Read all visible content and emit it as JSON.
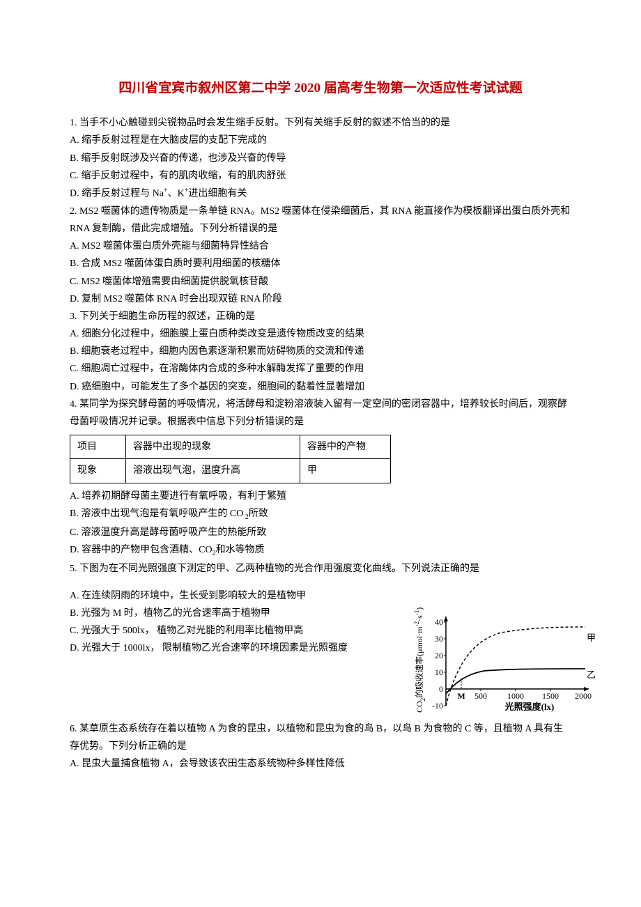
{
  "title": "四川省宜宾市叙州区第二中学 2020 届高考生物第一次适应性考试试题",
  "q1": {
    "stem": "1. 当手不小心触碰到尖锐物品时会发生缩手反射。下列有关缩手反射的叙述不恰当的的是",
    "A": "A. 缩手反射过程是在大脑皮层的支配下完成的",
    "B": "B. 缩手反射既涉及兴奋的传递，也涉及兴奋的传导",
    "C": "C. 缩手反射过程中，有的肌肉收缩，有的肌肉舒张",
    "D_pre": "D. 缩手反射过程与 Na",
    "D_mid": "、K",
    "D_post": "进出细胞有关"
  },
  "q2": {
    "stem": "2. MS2 噬菌体的遗传物质是一条单链 RNA。MS2 噬菌体在侵染细菌后，其 RNA 能直接作为模板翻译出蛋白质外壳和 RNA 复制酶，借此完成增殖。下列分析错误的是",
    "A": "A. MS2 噬菌体蛋白质外壳能与细菌特异性结合",
    "B": "B. 合成 MS2 噬菌体蛋白质时要利用细菌的核糖体",
    "C": "C. MS2 噬菌体增殖需要由细菌提供脱氧核苷酸",
    "D": "D. 复制 MS2 噬菌体 RNA 时会出现双链 RNA 阶段"
  },
  "q3": {
    "stem": "3. 下列关于细胞生命历程的叙述，正确的是",
    "A": "A. 细胞分化过程中，细胞膜上蛋白质种类改变是遗传物质改变的结果",
    "B": "B. 细胞衰老过程中，细胞内因色素逐渐积累而妨碍物质的交流和传递",
    "C": "C. 细胞凋亡过程中，在溶酶体内合成的多种水解酶发挥了重要的作用",
    "D": "D. 癌细胞中，可能发生了多个基因的突变，细胞间的黏着性显著增加"
  },
  "q4": {
    "stem": "4. 某同学为探究酵母菌的呼吸情况，将活酵母和淀粉溶液装入留有一定空间的密闭容器中，培养较长时间后，观察酵母菌呼吸情况并记录。根据表中信息下列分析错误的是",
    "table": {
      "r1c1": "项目",
      "r1c2": "容器中出现的现象",
      "r1c3": "容器中的产物",
      "r2c1": "现象",
      "r2c2": "溶液出现气泡，温度升高",
      "r2c3": "甲"
    },
    "A": "A. 培养初期酵母菌主要进行有氧呼吸，有利于繁殖",
    "B_pre": "B. 溶液中出现气泡是有氧呼吸产生的 CO",
    "B_num": " 2",
    "B_post": "所致",
    "C": "C. 溶液温度升高是酵母菌呼吸产生的热能所致",
    "D_pre": "D. 容器中的产物甲包含酒精、CO",
    "D_num": "2",
    "D_post": "和水等物质"
  },
  "q5": {
    "stem": "5. 下图为在不同光照强度下测定的甲、乙两种植物的光合作用强度变化曲线。下列说法正确的是",
    "A": "A. 在连续阴雨的环境中，生长受到影响较大的是植物甲",
    "B": "B. 光强为 M 时，植物乙的光合速率高于植物甲",
    "C": "C. 光强大于 500lx， 植物乙对光能的利用率比植物甲高",
    "D": "D. 光强大于 1000lx， 限制植物乙光合速率的环境因素是光照强度"
  },
  "q6": {
    "stem": "6. 某草原生态系统存在着以植物 A 为食的昆虫，以植物和昆虫为食的鸟 B，以鸟 B 为食物的 C 等，且植物 A 具有生存优势。下列分析正确的是",
    "A": "A. 昆虫大量捕食植物 A，会导致该农田生态系统物种多样性降低"
  },
  "chart": {
    "ylabel_pre": "CO",
    "ylabel_sub": "2",
    "ylabel_post": "的吸收速率(μmol·m",
    "ylabel_sup1": "-2",
    "ylabel_mid": "·s",
    "ylabel_sup2": "-1",
    "ylabel_end": ")",
    "xlabel": "光照强度(lx)",
    "series1": "甲",
    "series2": "乙",
    "yticks": [
      "-10",
      "0",
      "10",
      "20",
      "30",
      "40"
    ],
    "xticks": [
      "M",
      "500",
      "1000",
      "1500",
      "2000"
    ]
  },
  "chart_data": {
    "type": "line",
    "title": "",
    "xlabel": "光照强度(lx)",
    "ylabel": "CO2的吸收速率(μmol·m-2·s-1)",
    "ylim": [
      -10,
      40
    ],
    "xlim": [
      0,
      2000
    ],
    "x": [
      0,
      250,
      500,
      1000,
      1500,
      2000
    ],
    "series": [
      {
        "name": "甲",
        "values": [
          -10,
          10,
          25,
          33,
          36,
          37
        ]
      },
      {
        "name": "乙",
        "values": [
          -3,
          6,
          10,
          12,
          12,
          12
        ]
      }
    ],
    "annotations": [
      {
        "label": "M",
        "x": 250,
        "note": "x-axis mark between 0 and 500"
      }
    ]
  }
}
